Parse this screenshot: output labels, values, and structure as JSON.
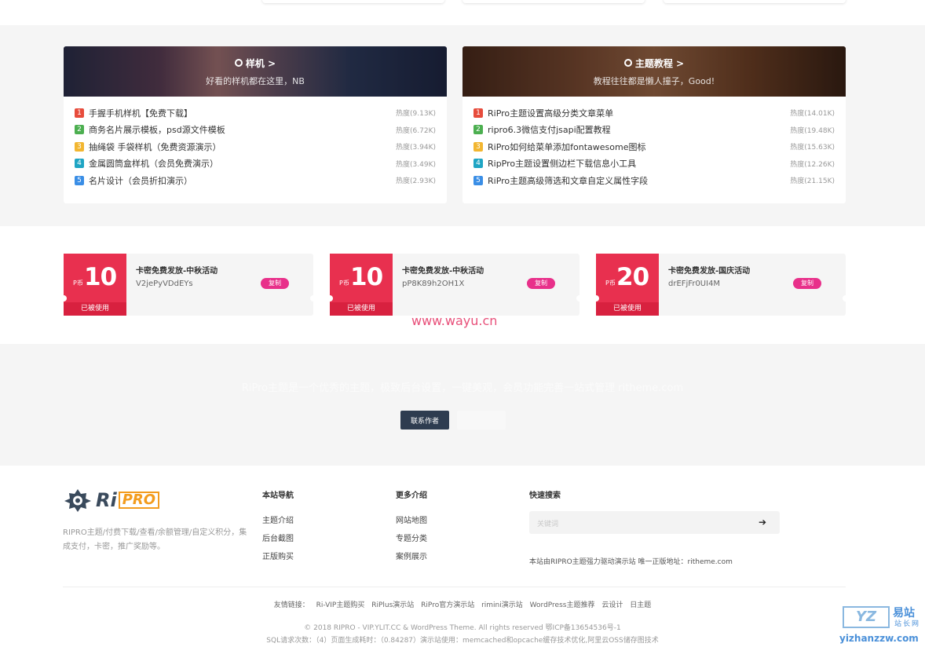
{
  "categories": [
    {
      "title": "样机 >",
      "subtitle": "好看的样机都在这里，NB",
      "items": [
        {
          "rank": "1",
          "title": "手握手机样机【免费下载】",
          "heat": "热度(9.13K)"
        },
        {
          "rank": "2",
          "title": "商务名片展示模板，psd源文件模板",
          "heat": "热度(6.72K)"
        },
        {
          "rank": "3",
          "title": "抽绳袋 手袋样机（免费资源演示）",
          "heat": "热度(3.94K)"
        },
        {
          "rank": "4",
          "title": "金属圆筒盒样机（会员免费演示）",
          "heat": "热度(3.49K)"
        },
        {
          "rank": "5",
          "title": "名片设计（会员折扣演示）",
          "heat": "热度(2.93K)"
        }
      ]
    },
    {
      "title": "主题教程 >",
      "subtitle": "教程往往都是懒人撞子，Good!",
      "items": [
        {
          "rank": "1",
          "title": "RiPro主题设置高级分类文章菜单",
          "heat": "热度(14.01K)"
        },
        {
          "rank": "2",
          "title": "ripro6.3微信支付jsapi配置教程",
          "heat": "热度(19.48K)"
        },
        {
          "rank": "3",
          "title": "RiPro如何给菜单添加fontawesome图标",
          "heat": "热度(15.63K)"
        },
        {
          "rank": "4",
          "title": "RipPro主题设置侧边栏下载信息小工具",
          "heat": "热度(12.26K)"
        },
        {
          "rank": "5",
          "title": "RiPro主题高级筛选和文章自定义属性字段",
          "heat": "热度(21.15K)"
        }
      ]
    }
  ],
  "coupons": [
    {
      "unit": "P币",
      "amount": "10",
      "status": "已被使用",
      "title": "卡密免费发放-中秋活动",
      "code": "V2jePyVDdEYs",
      "copy": "复制"
    },
    {
      "unit": "P币",
      "amount": "10",
      "status": "已被使用",
      "title": "卡密免费发放-中秋活动",
      "code": "pP8K89h2OH1X",
      "copy": "复制"
    },
    {
      "unit": "P币",
      "amount": "20",
      "status": "已被使用",
      "title": "卡密免费发放-国庆活动",
      "code": "drEFjFr0UI4M",
      "copy": "复制"
    }
  ],
  "watermark_text": "www.wayu.cn",
  "contact": {
    "faded_text": "RiPro主题是一个优秀的主题，极致后台设置，一键美观，会员功能完善一站式管理 ritheme.com",
    "button": "联系作者"
  },
  "footer": {
    "logo_ri": "Ri",
    "logo_pro": "PRO",
    "desc": "RIPRO主题/付费下载/查看/余额管理/自定义积分，集成支付，卡密，推广奖励等。",
    "nav_title": "本站导航",
    "nav_links": [
      "主题介绍",
      "后台截图",
      "正版购买"
    ],
    "more_title": "更多介绍",
    "more_links": [
      "网站地图",
      "专题分类",
      "案例展示"
    ],
    "search_title": "快速搜索",
    "search_placeholder": "关键词",
    "search_note": "本站由RIPRO主题强力驱动演示站 唯一正版地址：ritheme.com",
    "friends_label": "友情链接：",
    "friends": [
      "Ri-VIP主题购买",
      "RiPlus演示站",
      "RiPro官方演示站",
      "rimini演示站",
      "WordPress主题推荐",
      "云设计",
      "日主题"
    ],
    "copyright": "© 2018 RIPRO - VIP.YLIT.CC & WordPress Theme. All rights reserved  鄂ICP备13654536号-1",
    "sql_info": "SQL请求次数：（4）页面生成耗时：（0.84287）演示站使用：memcached和opcache缓存技术优化,阿里云OSS储存图技术"
  },
  "site_watermark": {
    "box": "YZ",
    "cn_1": "易站",
    "cn_2": "站长网",
    "url": "yizhanzzw.com"
  }
}
